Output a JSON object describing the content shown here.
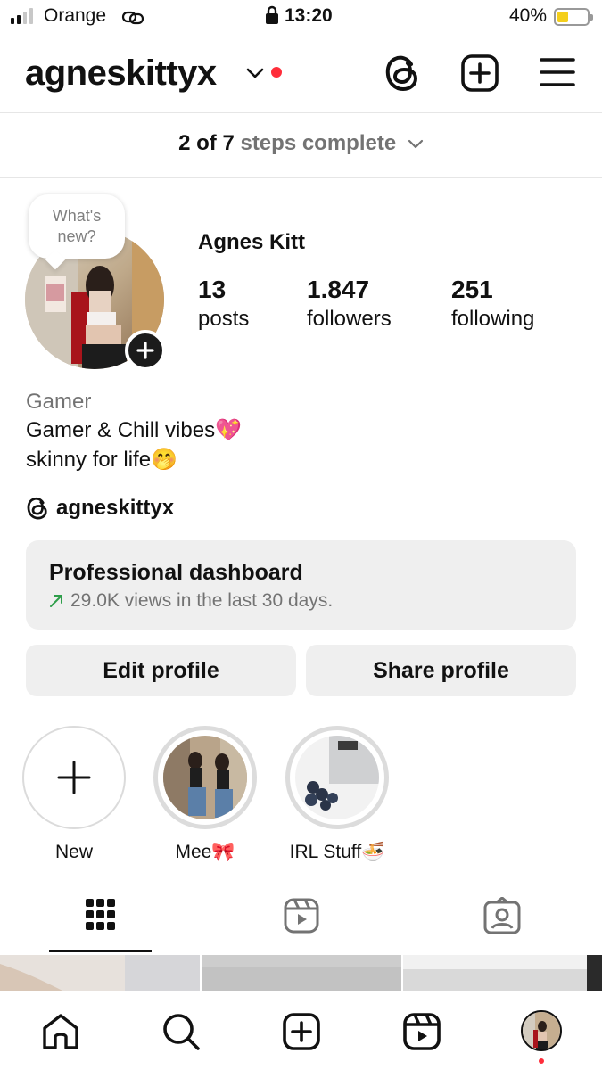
{
  "status_bar": {
    "carrier": "Orange",
    "time": "13:20",
    "battery": "40%",
    "battery_level": 0.4,
    "signal_bars_active": 2,
    "signal_bars_total": 4
  },
  "header": {
    "username": "agneskittyx",
    "icons": [
      "threads-icon",
      "create-post-icon",
      "menu-icon"
    ],
    "notification_dot_color": "#ff2d3a"
  },
  "steps": {
    "done": "2 of 7",
    "rest": "steps complete"
  },
  "profile": {
    "bubble_line1": "What's",
    "bubble_line2": "new?",
    "name": "Agnes Kitt",
    "stats": [
      {
        "value": "13",
        "label": "posts"
      },
      {
        "value": "1.847",
        "label": "followers"
      },
      {
        "value": "251",
        "label": "following"
      }
    ],
    "category": "Gamer",
    "bio_line1": "Gamer & Chill vibes💖",
    "bio_line2": "skinny for life🤭",
    "threads_handle": "agneskittyx"
  },
  "dashboard": {
    "title": "Professional dashboard",
    "subtitle": "29.0K views in the last 30 days.",
    "trend_color": "#2e9e4a"
  },
  "buttons": {
    "edit": "Edit profile",
    "share": "Share profile"
  },
  "highlights": [
    {
      "label": "New"
    },
    {
      "label": "Mee🎀"
    },
    {
      "label": "IRL Stuff🍜"
    }
  ],
  "tabs": [
    "grid-icon",
    "reels-icon",
    "tagged-icon"
  ],
  "bottom_nav": [
    "home-icon",
    "search-icon",
    "create-icon",
    "reels-icon",
    "profile-avatar"
  ]
}
